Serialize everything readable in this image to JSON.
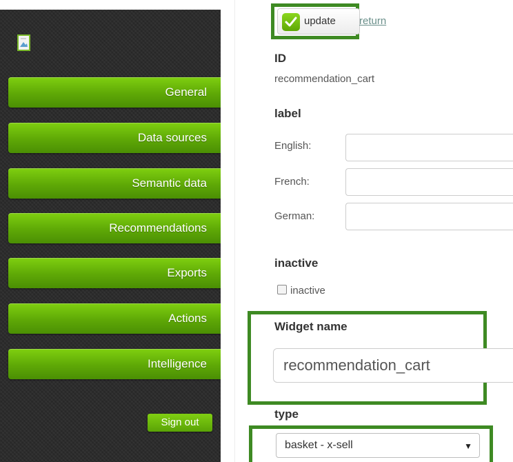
{
  "sidebar": {
    "logo_icon": "broken-image-icon",
    "items": [
      {
        "label": "General"
      },
      {
        "label": "Data sources"
      },
      {
        "label": "Semantic data"
      },
      {
        "label": "Recommendations"
      },
      {
        "label": "Exports"
      },
      {
        "label": "Actions"
      },
      {
        "label": "Intelligence"
      }
    ],
    "sign_out_label": "Sign out"
  },
  "toolbar": {
    "update_label": "update",
    "return_label": "return"
  },
  "form": {
    "id_label": "ID",
    "id_value": "recommendation_cart",
    "label_heading": "label",
    "languages": [
      {
        "name": "English:",
        "value": ""
      },
      {
        "name": "French:",
        "value": ""
      },
      {
        "name": "German:",
        "value": ""
      }
    ],
    "inactive_heading": "inactive",
    "inactive_checkbox_label": "inactive",
    "inactive_checked": false,
    "widget_name_label": "Widget name",
    "widget_name_value": "recommendation_cart",
    "type_label": "type",
    "type_value": "basket - x-sell"
  },
  "colors": {
    "accent_green": "#5ea806",
    "highlight_border": "#3e8a23",
    "sidebar_bg": "#2a2a2a",
    "link": "#6a8f8a"
  }
}
